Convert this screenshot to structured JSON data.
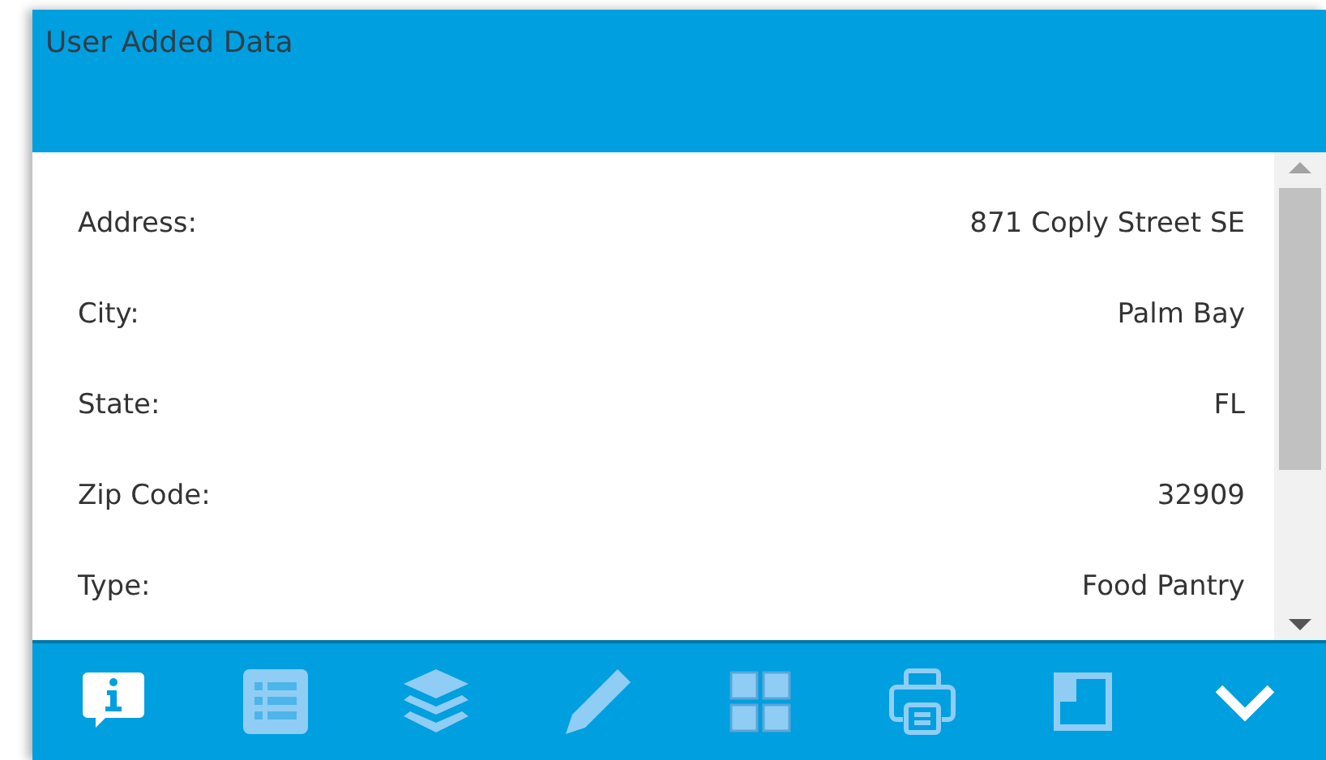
{
  "panel": {
    "title": "User Added Data"
  },
  "fields": [
    {
      "label": "Address:",
      "value": "871 Coply Street SE"
    },
    {
      "label": "City:",
      "value": "Palm Bay"
    },
    {
      "label": "State:",
      "value": "FL"
    },
    {
      "label": "Zip Code:",
      "value": "32909"
    },
    {
      "label": "Type:",
      "value": "Food Pantry"
    }
  ],
  "toolbar": [
    {
      "kind": "info",
      "selected": true
    },
    {
      "kind": "table",
      "selected": false
    },
    {
      "kind": "layers",
      "selected": false
    },
    {
      "kind": "edit",
      "selected": false
    },
    {
      "kind": "grid",
      "selected": false
    },
    {
      "kind": "print",
      "selected": false
    },
    {
      "kind": "dock",
      "selected": false
    }
  ],
  "collapse_button": {
    "kind": "collapse"
  }
}
